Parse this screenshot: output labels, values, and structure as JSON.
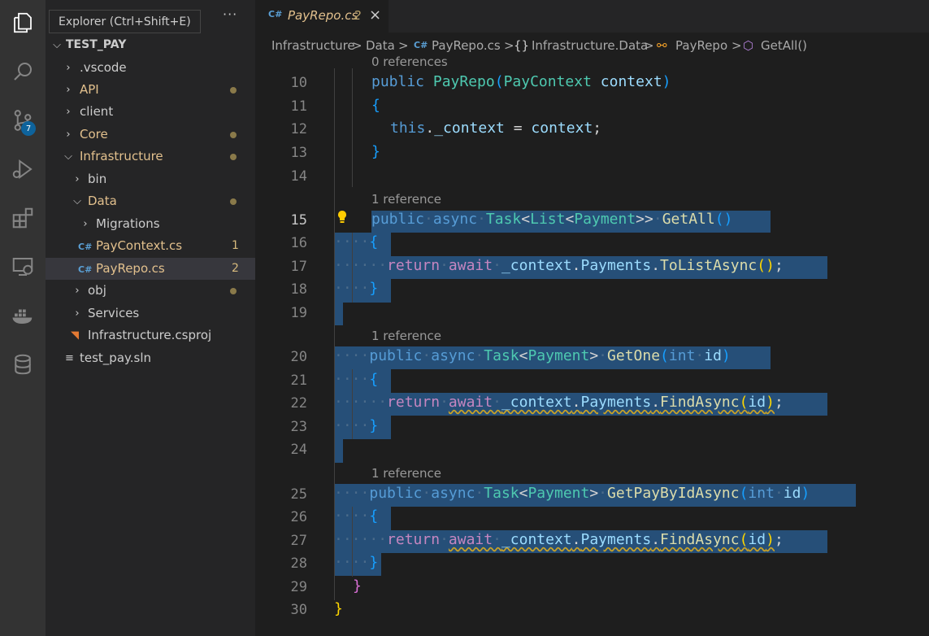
{
  "activity_bar": {
    "icons": [
      "explorer-icon",
      "search-icon",
      "source-control-icon",
      "run-debug-icon",
      "extensions-icon",
      "remote-explorer-icon",
      "docker-icon",
      "database-icon"
    ],
    "source_control_badge": "7"
  },
  "tooltip": {
    "text": "Explorer (Ctrl+Shift+E)"
  },
  "sidebar": {
    "more_label": "···",
    "workspace": "TEST_PAY",
    "items": [
      {
        "label": ".vscode",
        "modified": false
      },
      {
        "label": "API",
        "modified": true
      },
      {
        "label": "client",
        "modified": false
      },
      {
        "label": "Core",
        "modified": true
      },
      {
        "label": "Infrastructure",
        "modified": true
      },
      {
        "label": "bin",
        "modified": false
      },
      {
        "label": "Data",
        "modified": true
      },
      {
        "label": "Migrations",
        "modified": false
      },
      {
        "label": "PayContext.cs",
        "modified": true,
        "count": "1"
      },
      {
        "label": "PayRepo.cs",
        "modified": true,
        "count": "2",
        "selected": true
      },
      {
        "label": "obj",
        "modified": false
      },
      {
        "label": "Services",
        "modified": false
      },
      {
        "label": "Infrastructure.csproj",
        "modified": false
      },
      {
        "label": "test_pay.sln",
        "modified": false
      }
    ]
  },
  "tab": {
    "icon": "C#",
    "label": "PayRepo.cs",
    "problems": "2",
    "close": "×"
  },
  "breadcrumbs": {
    "items": [
      "Infrastructure",
      "Data",
      "PayRepo.cs",
      "Infrastructure.Data",
      "PayRepo",
      "GetAll()"
    ],
    "separator": ">"
  },
  "editor": {
    "code_lens": [
      "0 references",
      "1 reference",
      "1 reference",
      "1 reference"
    ],
    "line_numbers": [
      "10",
      "11",
      "12",
      "13",
      "14",
      "15",
      "16",
      "17",
      "18",
      "19",
      "20",
      "21",
      "22",
      "23",
      "24",
      "25",
      "26",
      "27",
      "28",
      "29",
      "30"
    ],
    "active_line": "15",
    "tokens": {
      "public": "public",
      "async": "async",
      "this": "this",
      "return": "return",
      "await": "await",
      "int": "int",
      "PayRepo": "PayRepo",
      "PayContext": "PayContext",
      "context": "context",
      "_context": "_context",
      "Task": "Task",
      "List": "List",
      "Payment": "Payment",
      "Payments": "Payments",
      "GetAll": "GetAll",
      "GetOne": "GetOne",
      "GetPayByIdAsync": "GetPayByIdAsync",
      "ToListAsync": "ToListAsync",
      "FindAsync": "FindAsync",
      "id": "id"
    }
  },
  "colors": {
    "keyword": "#569cd6",
    "type": "#4ec9b0",
    "function": "#dcdcaa",
    "variable": "#9cdcfe",
    "selection": "#264f78",
    "modified": "#e2c08d"
  }
}
